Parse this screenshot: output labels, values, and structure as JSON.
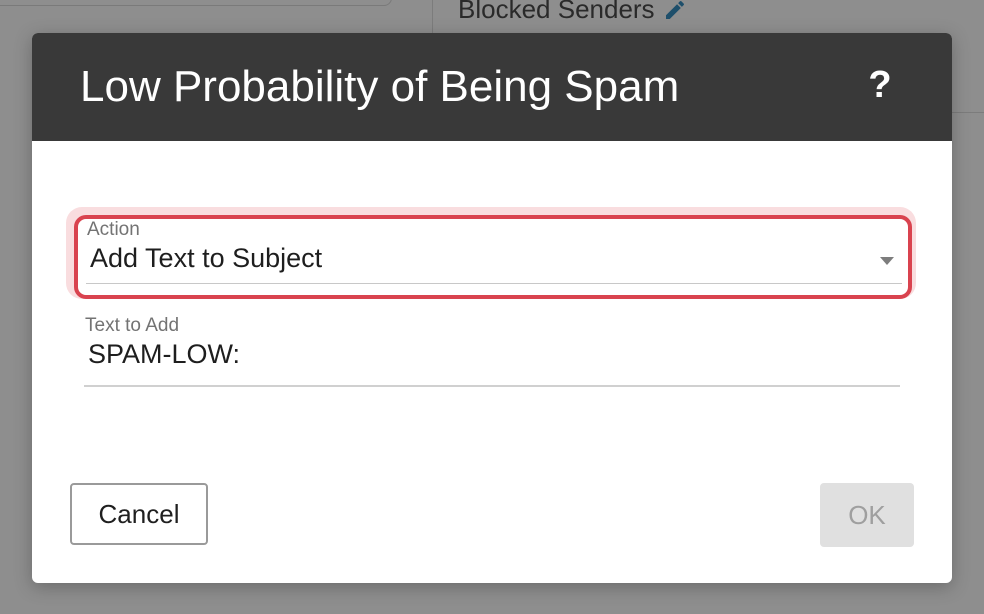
{
  "background": {
    "blocked_senders_label": "Blocked Senders",
    "edit_icon": "pencil-icon"
  },
  "dialog": {
    "title": "Low Probability of Being Spam",
    "help_label": "?",
    "action_field": {
      "label": "Action",
      "selected_value": "Add Text to Subject",
      "dropdown_icon": "caret-down-icon"
    },
    "text_field": {
      "label": "Text to Add",
      "value": "SPAM-LOW:"
    },
    "buttons": {
      "cancel_label": "Cancel",
      "ok_label": "OK"
    }
  },
  "colors": {
    "header_bg": "#393939",
    "focus_accent": "#d9434f",
    "disabled_button_bg": "#e0e0e0"
  }
}
